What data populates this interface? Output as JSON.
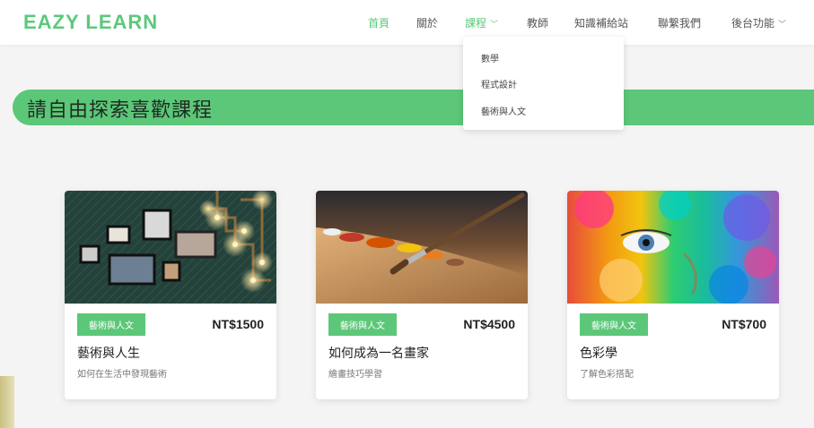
{
  "brand": "EAZY LEARN",
  "nav": {
    "items": [
      {
        "label": "首頁"
      },
      {
        "label": "關於"
      },
      {
        "label": "課程"
      },
      {
        "label": "教師"
      },
      {
        "label": "知識補給站"
      },
      {
        "label": "聯繫我們"
      },
      {
        "label": "後台功能"
      }
    ],
    "courses_dropdown": [
      "數學",
      "程式設計",
      "藝術與人文"
    ]
  },
  "banner": {
    "title": "請自由探索喜歡課程"
  },
  "courses": [
    {
      "category": "藝術與人文",
      "price": "NT$1500",
      "title": "藝術與人生",
      "subtitle": "如何在生活中發現藝術"
    },
    {
      "category": "藝術與人文",
      "price": "NT$4500",
      "title": "如何成為一名畫家",
      "subtitle": "繪畫技巧學習"
    },
    {
      "category": "藝術與人文",
      "price": "NT$700",
      "title": "色彩學",
      "subtitle": "了解色彩搭配"
    }
  ],
  "colors": {
    "accent": "#5cc778",
    "brand": "#5bc97a"
  }
}
